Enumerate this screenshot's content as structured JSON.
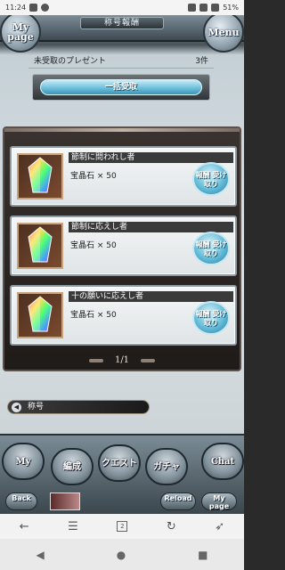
{
  "status_bar": {
    "time": "11:24",
    "battery": "51%"
  },
  "header": {
    "title": "称号報酬",
    "my_page": "My page",
    "menu": "Menu"
  },
  "presents": {
    "label": "未受取のプレゼント",
    "count": "3件",
    "bulk_button": "一括受取"
  },
  "rewards": [
    {
      "title": "節制に問われし者",
      "item": "宝晶石 × 50",
      "button": "報酬 受け取り"
    },
    {
      "title": "節制に応えし者",
      "item": "宝晶石 × 50",
      "button": "報酬 受け取り"
    },
    {
      "title": "十の願いに応えし者",
      "item": "宝晶石 × 50",
      "button": "報酬 受け取り"
    }
  ],
  "pager": {
    "text": "1/1"
  },
  "title_strip": {
    "label": "称号"
  },
  "bottom_nav": {
    "my_page": "My page",
    "party": "編成",
    "quest": "クエスト",
    "gacha": "ガチャ",
    "chat": "Chat",
    "back": "Back",
    "reload": "Reload",
    "my_page_small": "My page"
  },
  "browser": {
    "tabs": "2"
  },
  "colors": {
    "accent_blue": "#6dc0dc",
    "frame_dark": "#2a2420"
  },
  "icons": [
    "back-arrow-icon",
    "menu-lines-icon",
    "tabs-icon",
    "refresh-icon",
    "rocket-icon",
    "triangle-back-icon",
    "circle-home-icon",
    "square-recent-icon",
    "crystal-icon"
  ]
}
